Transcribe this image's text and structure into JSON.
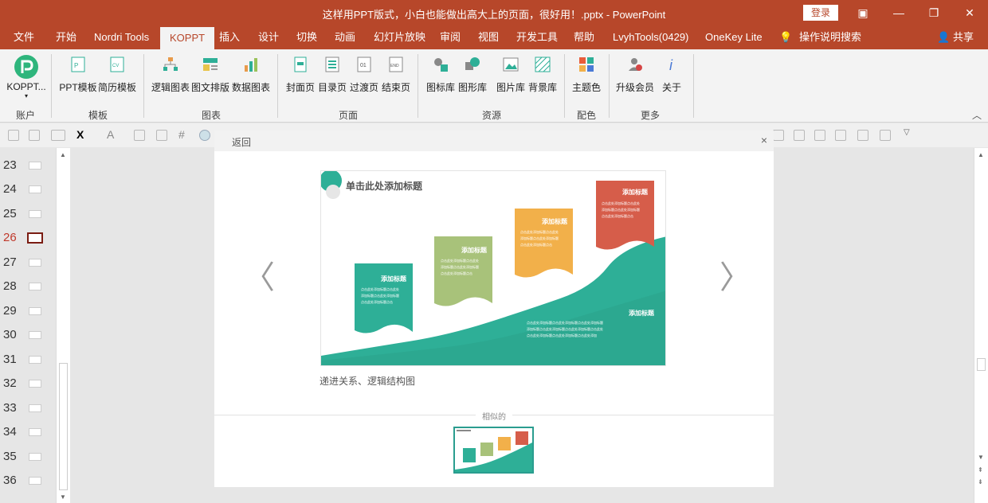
{
  "window": {
    "title": "这样用PPT版式，小白也能做出高大上的页面，很好用！.pptx - PowerPoint",
    "login_label": "登录"
  },
  "tabs": [
    {
      "label": "文件"
    },
    {
      "label": "开始"
    },
    {
      "label": "Nordri Tools"
    },
    {
      "label": "KOPPT"
    },
    {
      "label": "插入"
    },
    {
      "label": "设计"
    },
    {
      "label": "切换"
    },
    {
      "label": "动画"
    },
    {
      "label": "幻灯片放映"
    },
    {
      "label": "审阅"
    },
    {
      "label": "视图"
    },
    {
      "label": "开发工具"
    },
    {
      "label": "帮助"
    },
    {
      "label": "LvyhTools(0429)"
    },
    {
      "label": "OneKey Lite"
    },
    {
      "label": "操作说明搜索"
    },
    {
      "label": "共享"
    }
  ],
  "ribbon": {
    "koppt_button": "KOPPT...",
    "buttons": {
      "ppt_template": "PPT模板",
      "resume_template": "简历模板",
      "logic_chart": "逻辑图表",
      "text_layout": "图文排版",
      "data_chart": "数据图表",
      "cover_page": "封面页",
      "toc_page": "目录页",
      "transition_page": "过渡页",
      "end_page": "结束页",
      "icon_lib": "图标库",
      "shape_lib": "图形库",
      "image_lib": "图片库",
      "bg_lib": "背景库",
      "theme_color": "主题色",
      "upgrade": "升级会员",
      "about": "关于"
    },
    "groups": {
      "account": "账户",
      "template": "模板",
      "chart": "图表",
      "page": "页面",
      "resource": "资源",
      "color": "配色",
      "more": "更多"
    }
  },
  "slides": [
    {
      "num": "23"
    },
    {
      "num": "24"
    },
    {
      "num": "25"
    },
    {
      "num": "26"
    },
    {
      "num": "27"
    },
    {
      "num": "28"
    },
    {
      "num": "29"
    },
    {
      "num": "30"
    },
    {
      "num": "31"
    },
    {
      "num": "32"
    },
    {
      "num": "33"
    },
    {
      "num": "34"
    },
    {
      "num": "35"
    },
    {
      "num": "36"
    }
  ],
  "current_slide": "26",
  "panel": {
    "back_label": "返回",
    "close_label": "×",
    "prev_arrow": "〈",
    "next_arrow": "〉",
    "preview": {
      "title": "单击此处添加标题",
      "box_title": "添加标题",
      "box_text": "点击此处添加标题点击此处添加标题"
    },
    "caption": "递进关系、逻辑结构图",
    "similar_label": "相似的"
  },
  "colors": {
    "accent": "#b7472a",
    "teal": "#2eaf97",
    "green": "#a8c27a",
    "orange": "#f2b04a",
    "red": "#d65d4a"
  }
}
